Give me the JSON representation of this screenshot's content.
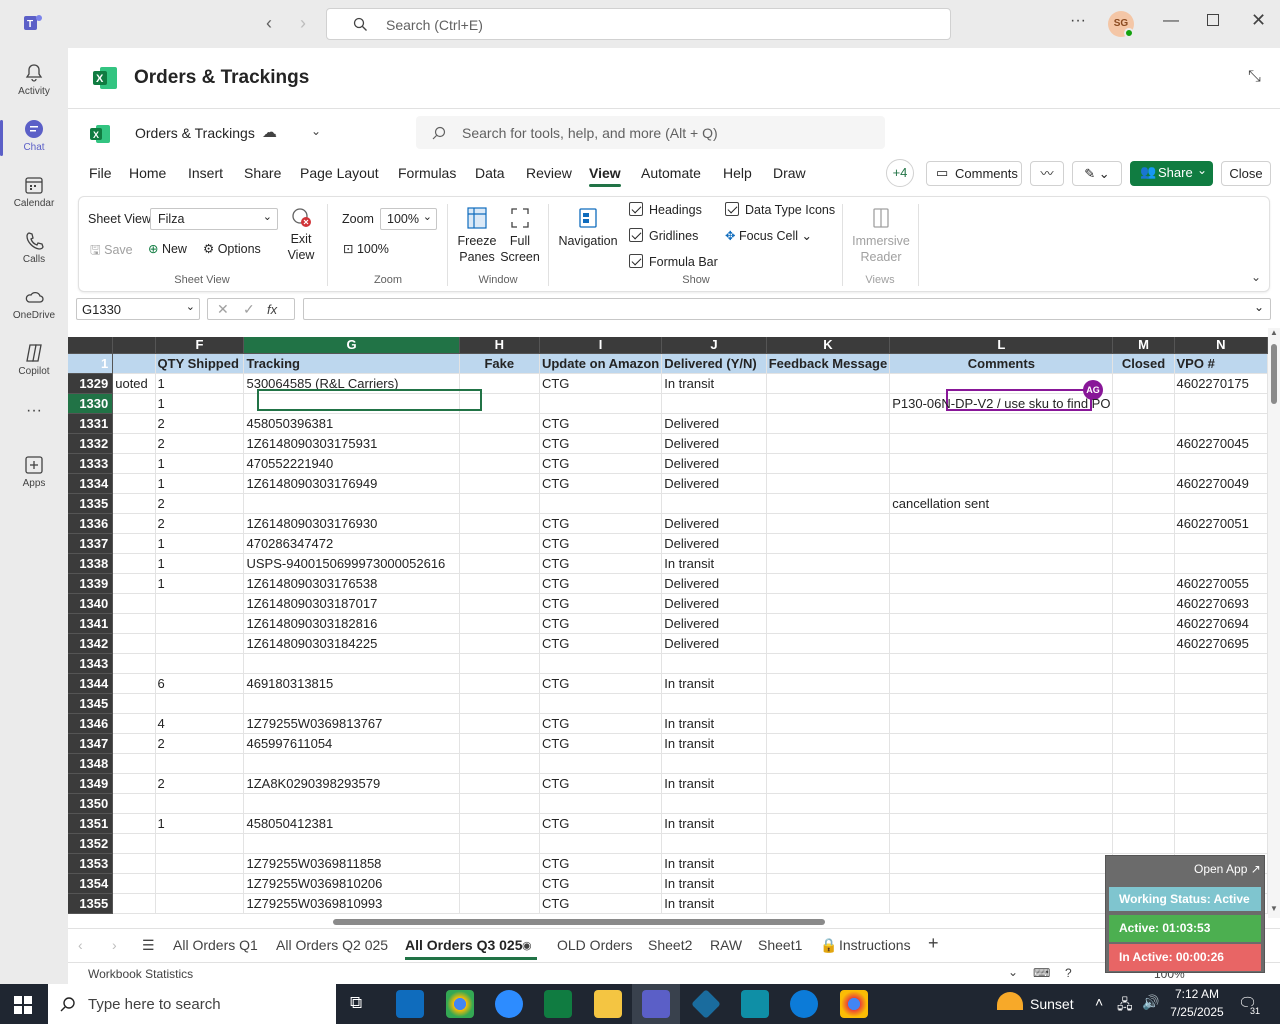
{
  "teams": {
    "search_placeholder": "Search (Ctrl+E)",
    "avatar_initials": "SG"
  },
  "sidebar": {
    "items": [
      {
        "label": "Activity"
      },
      {
        "label": "Chat"
      },
      {
        "label": "Calendar"
      },
      {
        "label": "Calls"
      },
      {
        "label": "OneDrive"
      },
      {
        "label": "Copilot"
      },
      {
        "label": "Apps"
      }
    ]
  },
  "app_title": "Orders & Trackings",
  "workbook": {
    "name": "Orders & Trackings",
    "search_placeholder": "Search for tools, help, and more (Alt + Q)"
  },
  "menu": {
    "items": [
      "File",
      "Home",
      "Insert",
      "Share",
      "Page Layout",
      "Formulas",
      "Data",
      "Review",
      "View",
      "Automate",
      "Help",
      "Draw"
    ],
    "active": "View",
    "plus_count": "+4",
    "comments": "Comments",
    "share": "Share",
    "close": "Close"
  },
  "ribbon": {
    "sheet_view_label": "Sheet View",
    "sheet_view_value": "Filza",
    "save": "Save",
    "new": "New",
    "options": "Options",
    "exit_view": "Exit View",
    "group_sheet_view": "Sheet View",
    "zoom_label": "Zoom",
    "zoom_value": "100%",
    "zoom_100": "100%",
    "group_zoom": "Zoom",
    "freeze_panes": "Freeze Panes",
    "full_screen": "Full Screen",
    "group_window": "Window",
    "navigation": "Navigation",
    "headings": "Headings",
    "gridlines": "Gridlines",
    "formula_bar": "Formula Bar",
    "data_type_icons": "Data Type Icons",
    "focus_cell": "Focus Cell",
    "group_show": "Show",
    "immersive_reader": "Immersive Reader",
    "group_views": "Views"
  },
  "formula_bar": {
    "name_box": "G1330",
    "fx": "fx"
  },
  "columns": [
    "F",
    "G",
    "H",
    "I",
    "J",
    "K",
    "L",
    "M",
    "N"
  ],
  "selected_column": "G",
  "header_row": {
    "num": "1",
    "cells": [
      "QTY Shipped",
      "Tracking",
      "Fake",
      "Update on Amazon",
      "Delivered (Y/N)",
      "Feedback Message",
      "Comments",
      "Closed",
      "VPO #"
    ]
  },
  "rows": [
    {
      "num": "1329",
      "e": "uoted",
      "f": "1",
      "g": "530064585 (R&L Carriers)",
      "h": "",
      "i": "CTG",
      "j": "In transit",
      "k": "",
      "l": "",
      "m": "",
      "n": "4602270175"
    },
    {
      "num": "1330",
      "e": "",
      "f": "1",
      "g": "",
      "h": "",
      "i": "",
      "j": "",
      "k": "",
      "l": "P130-06N-DP-V2 / use sku to find PO",
      "m": "",
      "n": ""
    },
    {
      "num": "1331",
      "e": "",
      "f": "2",
      "g": "458050396381",
      "h": "",
      "i": "CTG",
      "j": "Delivered",
      "k": "",
      "l": "",
      "m": "",
      "n": ""
    },
    {
      "num": "1332",
      "e": "",
      "f": "2",
      "g": "1Z6148090303175931",
      "h": "",
      "i": "CTG",
      "j": "Delivered",
      "k": "",
      "l": "",
      "m": "",
      "n": "4602270045"
    },
    {
      "num": "1333",
      "e": "",
      "f": "1",
      "g": "470552221940",
      "h": "",
      "i": "CTG",
      "j": "Delivered",
      "k": "",
      "l": "",
      "m": "",
      "n": ""
    },
    {
      "num": "1334",
      "e": "",
      "f": "1",
      "g": "1Z6148090303176949",
      "h": "",
      "i": "CTG",
      "j": "Delivered",
      "k": "",
      "l": "",
      "m": "",
      "n": "4602270049"
    },
    {
      "num": "1335",
      "e": "",
      "f": "2",
      "g": "",
      "h": "",
      "i": "",
      "j": "",
      "k": "",
      "l": "cancellation sent",
      "m": "",
      "n": ""
    },
    {
      "num": "1336",
      "e": "",
      "f": "2",
      "g": "1Z6148090303176930",
      "h": "",
      "i": "CTG",
      "j": "Delivered",
      "k": "",
      "l": "",
      "m": "",
      "n": "4602270051"
    },
    {
      "num": "1337",
      "e": "",
      "f": "1",
      "g": "470286347472",
      "h": "",
      "i": "CTG",
      "j": "Delivered",
      "k": "",
      "l": "",
      "m": "",
      "n": ""
    },
    {
      "num": "1338",
      "e": "",
      "f": "1",
      "g": "USPS-9400150699973000052616",
      "h": "",
      "i": "CTG",
      "j": "In transit",
      "k": "",
      "l": "",
      "m": "",
      "n": ""
    },
    {
      "num": "1339",
      "e": "",
      "f": "1",
      "g": "1Z6148090303176538",
      "h": "",
      "i": "CTG",
      "j": "Delivered",
      "k": "",
      "l": "",
      "m": "",
      "n": "4602270055"
    },
    {
      "num": "1340",
      "e": "",
      "f": "",
      "g": "1Z6148090303187017",
      "h": "",
      "i": "CTG",
      "j": "Delivered",
      "k": "",
      "l": "",
      "m": "",
      "n": "4602270693"
    },
    {
      "num": "1341",
      "e": "",
      "f": "",
      "g": "1Z6148090303182816",
      "h": "",
      "i": "CTG",
      "j": "Delivered",
      "k": "",
      "l": "",
      "m": "",
      "n": "4602270694"
    },
    {
      "num": "1342",
      "e": "",
      "f": "",
      "g": "1Z6148090303184225",
      "h": "",
      "i": "CTG",
      "j": "Delivered",
      "k": "",
      "l": "",
      "m": "",
      "n": "4602270695"
    },
    {
      "num": "1343",
      "e": "",
      "f": "",
      "g": "",
      "h": "",
      "i": "",
      "j": "",
      "k": "",
      "l": "",
      "m": "",
      "n": ""
    },
    {
      "num": "1344",
      "e": "",
      "f": "6",
      "g": "469180313815",
      "h": "",
      "i": "CTG",
      "j": "In transit",
      "k": "",
      "l": "",
      "m": "",
      "n": ""
    },
    {
      "num": "1345",
      "e": "",
      "f": "",
      "g": "",
      "h": "",
      "i": "",
      "j": "",
      "k": "",
      "l": "",
      "m": "",
      "n": ""
    },
    {
      "num": "1346",
      "e": "",
      "f": "4",
      "g": "1Z79255W0369813767",
      "h": "",
      "i": "CTG",
      "j": "In transit",
      "k": "",
      "l": "",
      "m": "",
      "n": ""
    },
    {
      "num": "1347",
      "e": "",
      "f": "2",
      "g": "465997611054",
      "h": "",
      "i": "CTG",
      "j": "In transit",
      "k": "",
      "l": "",
      "m": "",
      "n": ""
    },
    {
      "num": "1348",
      "e": "",
      "f": "",
      "g": "",
      "h": "",
      "i": "",
      "j": "",
      "k": "",
      "l": "",
      "m": "",
      "n": ""
    },
    {
      "num": "1349",
      "e": "",
      "f": "2",
      "g": "1ZA8K0290398293579",
      "h": "",
      "i": "CTG",
      "j": "In transit",
      "k": "",
      "l": "",
      "m": "",
      "n": ""
    },
    {
      "num": "1350",
      "e": "",
      "f": "",
      "g": "",
      "h": "",
      "i": "",
      "j": "",
      "k": "",
      "l": "",
      "m": "",
      "n": ""
    },
    {
      "num": "1351",
      "e": "",
      "f": "1",
      "g": "458050412381",
      "h": "",
      "i": "CTG",
      "j": "In transit",
      "k": "",
      "l": "",
      "m": "",
      "n": ""
    },
    {
      "num": "1352",
      "e": "",
      "f": "",
      "g": "",
      "h": "",
      "i": "",
      "j": "",
      "k": "",
      "l": "",
      "m": "",
      "n": ""
    },
    {
      "num": "1353",
      "e": "",
      "f": "",
      "g": "1Z79255W0369811858",
      "h": "",
      "i": "CTG",
      "j": "In transit",
      "k": "",
      "l": "",
      "m": "",
      "n": ""
    },
    {
      "num": "1354",
      "e": "",
      "f": "",
      "g": "1Z79255W0369810206",
      "h": "",
      "i": "CTG",
      "j": "In transit",
      "k": "",
      "l": "",
      "m": "",
      "n": ""
    },
    {
      "num": "1355",
      "e": "",
      "f": "",
      "g": "1Z79255W0369810993",
      "h": "",
      "i": "CTG",
      "j": "In transit",
      "k": "",
      "l": "",
      "m": "",
      "n": ""
    }
  ],
  "collab_badge": "AG",
  "sheet_tabs": [
    "All Orders Q1",
    "All Orders Q2 025",
    "All Orders Q3 025",
    "OLD Orders",
    "Sheet2",
    "RAW",
    "Sheet1",
    "Instructions"
  ],
  "active_tab": "All Orders Q3 025",
  "status": {
    "workbook_statistics": "Workbook Statistics",
    "zoom": "100%"
  },
  "work_widget": {
    "open_app": "Open App ↗",
    "status": "Working Status: Active",
    "active": "Active: 01:03:53",
    "inactive": "In Active: 00:00:26"
  },
  "taskbar": {
    "search_placeholder": "Type here to search",
    "weather": "Sunset",
    "time": "7:12 AM",
    "date": "7/25/2025",
    "notif_count": "31"
  },
  "colors": {
    "accent": "#217346",
    "teams": "#5b5fc7",
    "header_fill": "#bdd7ee",
    "share_btn": "#107c41"
  }
}
